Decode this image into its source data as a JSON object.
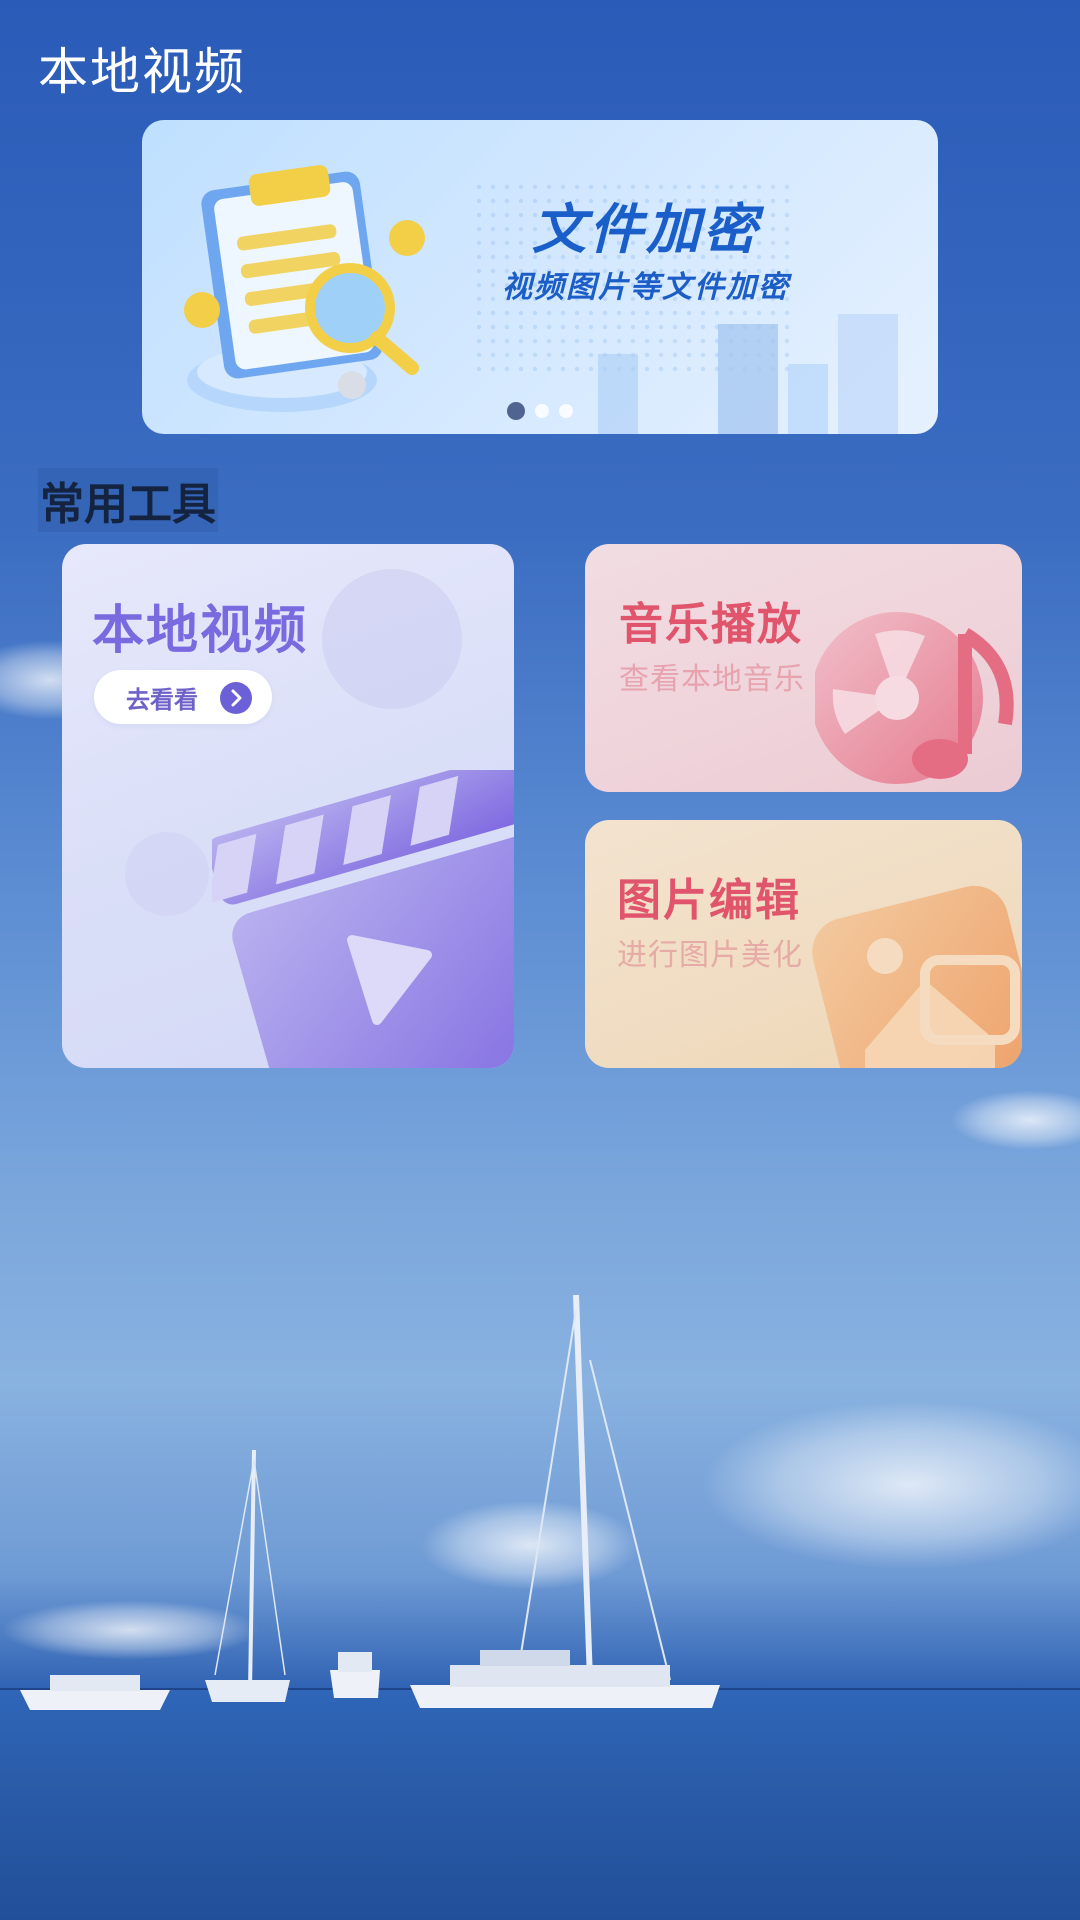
{
  "app": {
    "title": "本地视频"
  },
  "banner": {
    "title": "文件加密",
    "subtitle": "视频图片等文件加密",
    "dots": [
      true,
      false,
      false
    ]
  },
  "section": {
    "title": "常用工具"
  },
  "tools": {
    "video": {
      "title": "本地视频",
      "button_label": "去看看",
      "icon": "clapperboard-icon"
    },
    "music": {
      "title": "音乐播放",
      "subtitle": "查看本地音乐",
      "icon": "music-disc-icon"
    },
    "photo": {
      "title": "图片编辑",
      "subtitle": "进行图片美化",
      "icon": "photo-icon"
    }
  },
  "colors": {
    "video_accent": "#7a6ae0",
    "music_accent": "#e0546c",
    "photo_accent": "#e0546c",
    "banner_accent": "#1a5fc9"
  }
}
